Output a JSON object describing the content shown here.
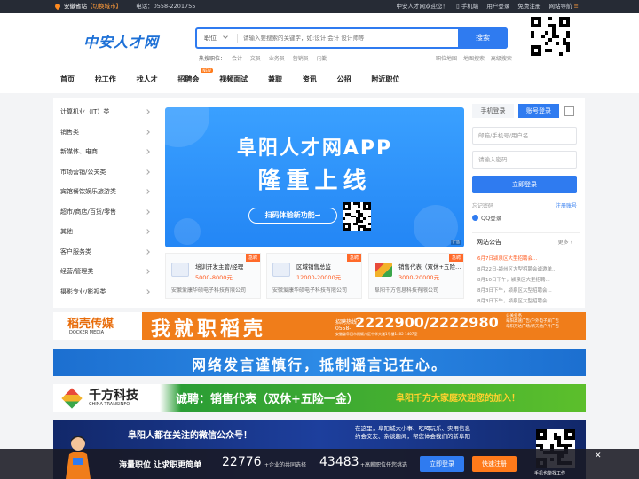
{
  "topbar": {
    "location": "安徽省站",
    "switch": "【切换城市】",
    "phone": "电话：0558-2201755",
    "welcome": "中安人才网欢迎您！",
    "mobile": "手机端",
    "user_login": "用户登录",
    "free_register": "免费注册",
    "site_nav": "网站导航"
  },
  "header": {
    "logo": "中安人才网"
  },
  "search": {
    "select": "职位",
    "placeholder": "请输入要搜索的关键字，如:设计 会计 设计师等",
    "button": "搜索"
  },
  "hot": {
    "label": "热搜职位：",
    "items": [
      "会计",
      "文员",
      "业务员",
      "营销员",
      "内勤"
    ]
  },
  "adv": [
    "职位地图",
    "地图搜索",
    "高级搜索"
  ],
  "nav": {
    "items": [
      "首页",
      "找工作",
      "找人才",
      "招聘会",
      "视频面试",
      "兼职",
      "资讯",
      "公招",
      "附近职位"
    ],
    "new_badge": "NEW"
  },
  "categories": [
    "计算机业（IT）类",
    "销售类",
    "新媒体、电商",
    "市场营销/公关类",
    "宾馆餐饮娱乐旅游类",
    "超市/商店/百货/零售",
    "其他",
    "客户服务类",
    "经营/管理类",
    "摄影专业/影视类"
  ],
  "banner": {
    "line1": "阜阳人才网APP",
    "line2": "隆重上线",
    "scan": "扫码体验新功能→",
    "tag": "广告"
  },
  "jobs": [
    {
      "hot": "急聘",
      "title": "培训开发主管/经理",
      "salary": "5000-8000元",
      "company": "安徽爱康华硕电子科技有限公司"
    },
    {
      "hot": "急聘",
      "title": "区域销售总监",
      "salary": "12000-20000元",
      "company": "安徽爱康华硕电子科技有限公司"
    },
    {
      "hot": "急聘",
      "title": "销售代表（双休+五险…",
      "salary": "3000-20000元",
      "company": "阜阳千方信息科技有限公司"
    }
  ],
  "login": {
    "tab_phone": "手机登录",
    "tab_account": "账号登录",
    "user_placeholder": "邮箱/手机号/用户名",
    "pwd_placeholder": "请输入密码",
    "button": "立即登录",
    "forgot": "忘记密码",
    "register": "注册账号",
    "qq": "QQ登录"
  },
  "notice": {
    "title": "网站公告",
    "more": "更多",
    "items": [
      "6月7日颍泉区大型招聘会...",
      "8月22日-颍州区大型招聘会诚邀单...",
      "8月10日下午，颍泉区大型招聘...",
      "8月3日下午，颍泉区大型招聘会...",
      "8月3日下午，颍泉区大型招聘会..."
    ]
  },
  "ads": {
    "ad1": {
      "brand": "稻壳传媒",
      "brand_en": "DOCKER MEDIA",
      "slogan": "我就职稻壳",
      "pre": "招聘热线：",
      "area": "0558-",
      "phone": "2222900/2222980",
      "addr": "安徽省阜阳市阳颍州区中华大道1号楼1402-1407室",
      "side1": "公关业务",
      "side2": "阜阳高速广告/户外电子屏广告",
      "side3": "阜阳万达广场/新天地户外广告"
    },
    "ad2": {
      "text": "网络发言谨慎行，抵制谣言记在心。"
    },
    "ad3": {
      "brand": "千方科技",
      "brand_en": "CHINA TRANSINFO",
      "main": "诚聘：销售代表（双休+五险一金）",
      "right": "阜阳千方大家庭欢迎您的加入！"
    },
    "ad4": {
      "text": "阜阳人都在关注的微信公众号！",
      "r1": "在这里，阜阳城大小事、吃喝玩乐、实用信息",
      "r2": "约会交友、杂谈趣闻，帮您体会我们的新阜阳"
    }
  },
  "footer_qr": "手机也能找工作",
  "bottom": {
    "slogan": "海量职位 让求职更简单",
    "num1": "22776",
    "label1": "+企业的共同选择",
    "num2": "43483",
    "label2": "+高薪职位任您挑选",
    "login": "立即登录",
    "register": "快速注册",
    "close": "✕"
  }
}
